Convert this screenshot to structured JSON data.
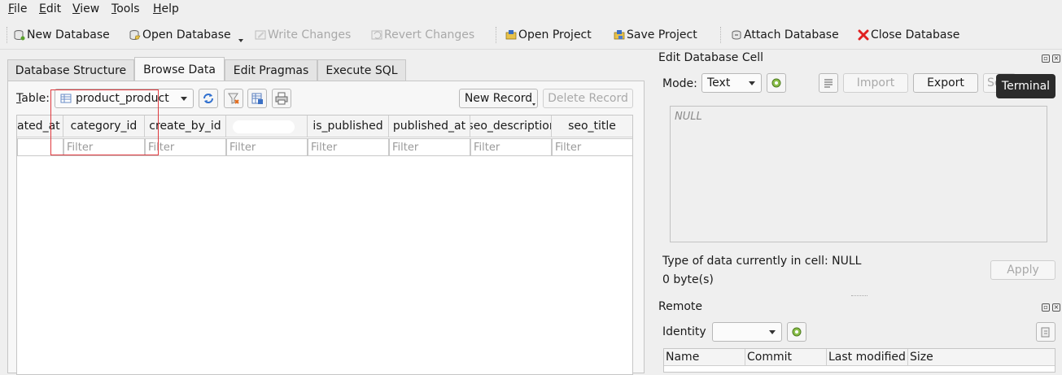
{
  "menu": [
    {
      "label": "File",
      "ul": "F",
      "rest": "ile"
    },
    {
      "label": "Edit",
      "ul": "E",
      "rest": "dit"
    },
    {
      "label": "View",
      "ul": "V",
      "rest": "iew"
    },
    {
      "label": "Tools",
      "ul": "T",
      "rest": "ools"
    },
    {
      "label": "Help",
      "ul": "H",
      "rest": "elp"
    }
  ],
  "toolbar": {
    "new_database": "New Database",
    "open_database": "Open Database",
    "write_changes": "Write Changes",
    "revert_changes": "Revert Changes",
    "open_project": "Open Project",
    "save_project": "Save Project",
    "attach_database": "Attach Database",
    "close_database": "Close Database"
  },
  "tabs": [
    "Database Structure",
    "Browse Data",
    "Edit Pragmas",
    "Execute SQL"
  ],
  "browse": {
    "table_label_ul": "T",
    "table_label_rest": "able:",
    "table_value": "product_product",
    "new_record": "New Record",
    "delete_record": "Delete Record",
    "columns": [
      "ated_at",
      "category_id",
      "create_by_id",
      "",
      "is_published",
      "published_at",
      "seo_descriptior",
      "seo_title"
    ],
    "filter_placeholder": "Filter"
  },
  "edit_cell": {
    "title": "Edit Database Cell",
    "mode_label": "Mode:",
    "mode_value": "Text",
    "import": "Import",
    "export": "Export",
    "set_partial": "Se",
    "content": "NULL",
    "type_info": "Type of data currently in cell: NULL",
    "size_info": "0 byte(s)",
    "apply": "Apply"
  },
  "tooltip": "Terminal",
  "remote": {
    "title": "Remote",
    "identity_label": "Identity",
    "columns": [
      "Name",
      "Commit",
      "Last modified",
      "Size"
    ]
  },
  "colors": {
    "highlight_box": "#e0393e",
    "close_icon": "#e02020",
    "tooltip_bg": "#2b2b2b"
  }
}
